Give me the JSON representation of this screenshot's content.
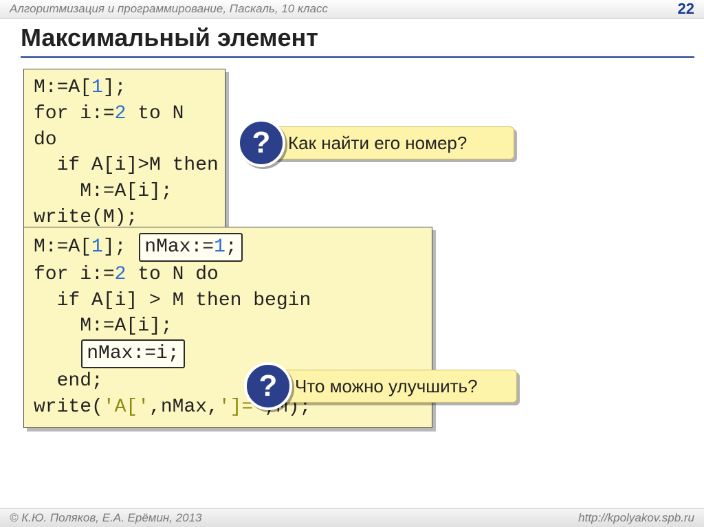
{
  "header": {
    "breadcrumb": "Алгоритмизация и программирование, Паскаль, 10 класс",
    "page_number": "22"
  },
  "title": "Максимальный элемент",
  "code1": {
    "l1_a": "M:=",
    "l1_b": "A[",
    "l1_num": "1",
    "l1_c": "];",
    "l2_a": "for i:=",
    "l2_num": "2",
    "l2_b": " to N do",
    "l3": "  if A[i]>M then",
    "l4": "    M:=A[i];",
    "l5": "write(M);"
  },
  "q1": {
    "mark": "?",
    "text": "Как найти его номер?"
  },
  "code2": {
    "l1_a": "M:=",
    "l1_b": "A[",
    "l1_num": "1",
    "l1_c": "]; ",
    "l1_hl_a": "nMax:=",
    "l1_hl_num": "1",
    "l1_hl_b": ";",
    "l2_a": "for i:=",
    "l2_num": "2",
    "l2_b": " to N do",
    "l3": "  if A[i] > M then begin",
    "l4": "    M:=A[i];",
    "l5_hl": "nMax:=i;",
    "l6": "  end;",
    "l7_a": "write(",
    "l7_s1": "'A['",
    "l7_b": ",nMax,",
    "l7_s2": "']='",
    "l7_c": ",M);"
  },
  "q2": {
    "mark": "?",
    "text": "Что можно улучшить?"
  },
  "footer": {
    "copyright": "© К.Ю. Поляков, Е.А. Ерёмин, 2013",
    "url": "http://kpolyakov.spb.ru"
  }
}
